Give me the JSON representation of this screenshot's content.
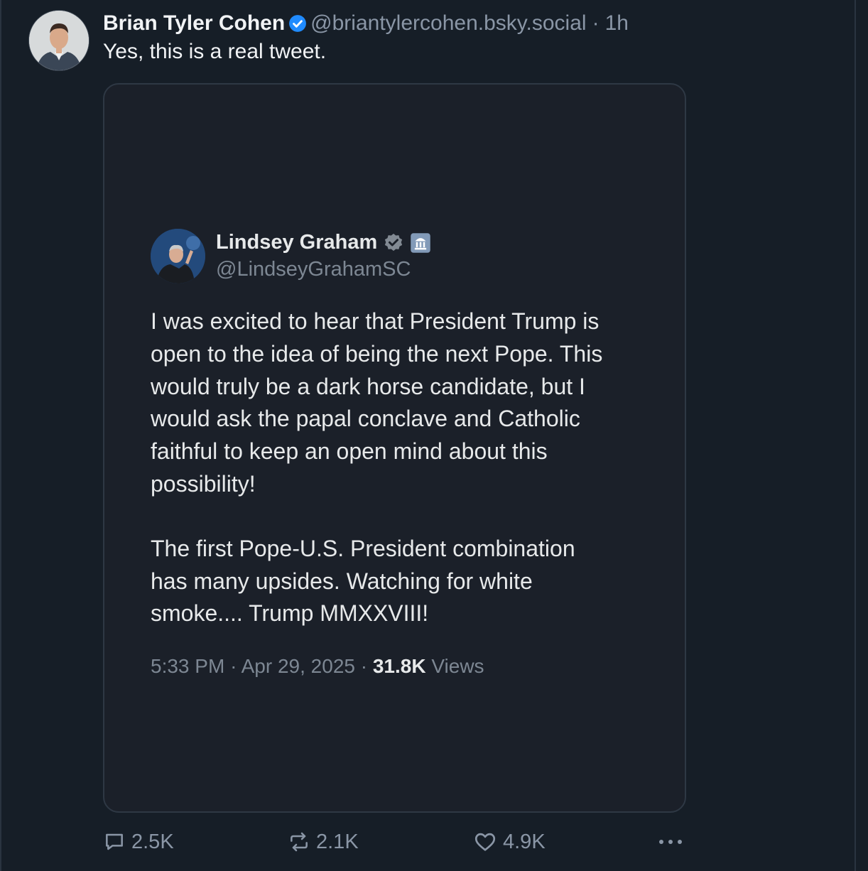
{
  "post": {
    "author_name": "Brian Tyler Cohen",
    "handle": "@briantylercohen.bsky.social",
    "separator": "·",
    "timestamp": "1h",
    "text": "Yes, this is a real tweet."
  },
  "embed": {
    "author_name": "Lindsey Graham",
    "handle": "@LindseyGrahamSC",
    "paragraph1": [
      "I was excited to hear that President Trump is",
      "open to the idea of being the next Pope. This",
      "would truly be a dark horse candidate, but I",
      "would ask the papal conclave and Catholic",
      "faithful to keep an open mind about this",
      "possibility!"
    ],
    "paragraph2": [
      "The first Pope-U.S. President combination",
      "has many upsides. Watching for white",
      "smoke.... Trump MMXXVIII!"
    ],
    "time": "5:33 PM",
    "sep": "·",
    "date": "Apr 29, 2025",
    "views_count": "31.8K",
    "views_label": "Views"
  },
  "actions": {
    "replies": "2.5K",
    "reposts": "2.1K",
    "likes": "4.9K"
  },
  "icons": {
    "verified": "verified-check-icon",
    "gov": "government-building-icon",
    "reply": "speech-bubble-icon",
    "repost": "repost-arrows-icon",
    "like": "heart-icon",
    "more": "ellipsis-icon"
  },
  "colors": {
    "background": "#161e27",
    "verified_blue": "#208bfe",
    "text": "#f1f3f5",
    "muted": "#8a96a6"
  }
}
